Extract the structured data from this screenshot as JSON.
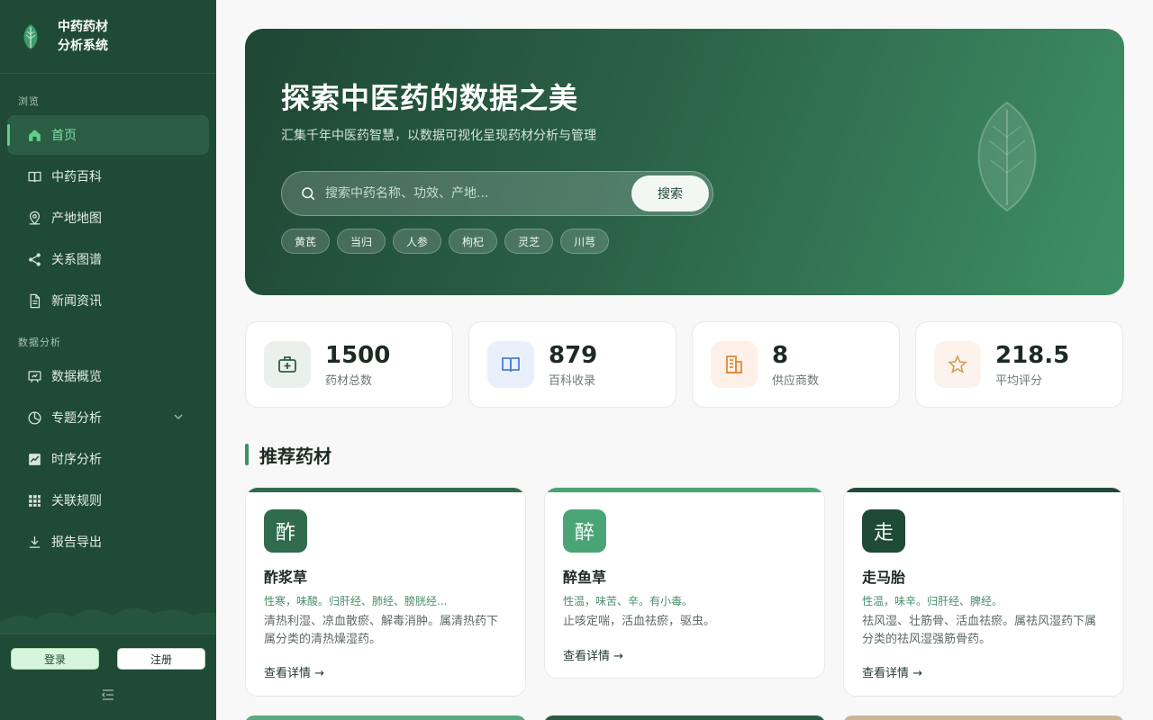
{
  "app": {
    "title_line1": "中药药材",
    "title_line2": "分析系统"
  },
  "nav": {
    "section_browse": "浏览",
    "section_analysis": "数据分析",
    "browse_items": [
      {
        "label": "首页",
        "icon": "home-icon"
      },
      {
        "label": "中药百科",
        "icon": "book-icon"
      },
      {
        "label": "产地地图",
        "icon": "map-pin-icon"
      },
      {
        "label": "关系图谱",
        "icon": "share-icon"
      },
      {
        "label": "新闻资讯",
        "icon": "document-icon"
      }
    ],
    "analysis_items": [
      {
        "label": "数据概览",
        "icon": "dashboard-icon"
      },
      {
        "label": "专题分析",
        "icon": "pie-chart-icon"
      },
      {
        "label": "时序分析",
        "icon": "line-chart-icon"
      },
      {
        "label": "关联规则",
        "icon": "grid-icon"
      },
      {
        "label": "报告导出",
        "icon": "download-icon"
      }
    ]
  },
  "auth": {
    "login": "登录",
    "register": "注册"
  },
  "hero": {
    "title": "探索中医药的数据之美",
    "subtitle": "汇集千年中医药智慧，以数据可视化呈现药材分析与管理",
    "search_placeholder": "搜索中药名称、功效、产地...",
    "search_button": "搜索",
    "tags": [
      "黄芪",
      "当归",
      "人参",
      "枸杞",
      "灵芝",
      "川芎"
    ]
  },
  "stats": [
    {
      "value": "1500",
      "label": "药材总数",
      "icon": "medkit-icon",
      "bg": "#ebf0ed",
      "color": "#2f5d45"
    },
    {
      "value": "879",
      "label": "百科收录",
      "icon": "book-icon",
      "bg": "#eaf0fb",
      "color": "#4a7fd6"
    },
    {
      "value": "8",
      "label": "供应商数",
      "icon": "building-icon",
      "bg": "#fdf0e6",
      "color": "#e08a3c"
    },
    {
      "value": "218.5",
      "label": "平均评分",
      "icon": "star-icon",
      "bg": "#fcf3ec",
      "color": "#d89a5c"
    }
  ],
  "section_title": "推荐药材",
  "cards": [
    {
      "char": "酢",
      "name": "酢浆草",
      "prop": "性寒，味酸。归肝经、肺经、膀胱经...",
      "desc": "清热利湿、凉血散瘀、解毒消肿。属清热药下属分类的清热燥湿药。",
      "link": "查看详情 →",
      "color": "#2f6b4c"
    },
    {
      "char": "醉",
      "name": "醉鱼草",
      "prop": "性温，味苦、辛。有小毒。",
      "desc": "止咳定喘，活血祛瘀，驱虫。",
      "link": "查看详情 →",
      "color": "#4aa575"
    },
    {
      "char": "走",
      "name": "走马胎",
      "prop": "性温，味辛。归肝经、脾经。",
      "desc": "祛风湿、壮筋骨、活血祛瘀。属祛风湿药下属分类的祛风湿强筋骨药。",
      "link": "查看详情 →",
      "color": "#1f4a35"
    }
  ]
}
